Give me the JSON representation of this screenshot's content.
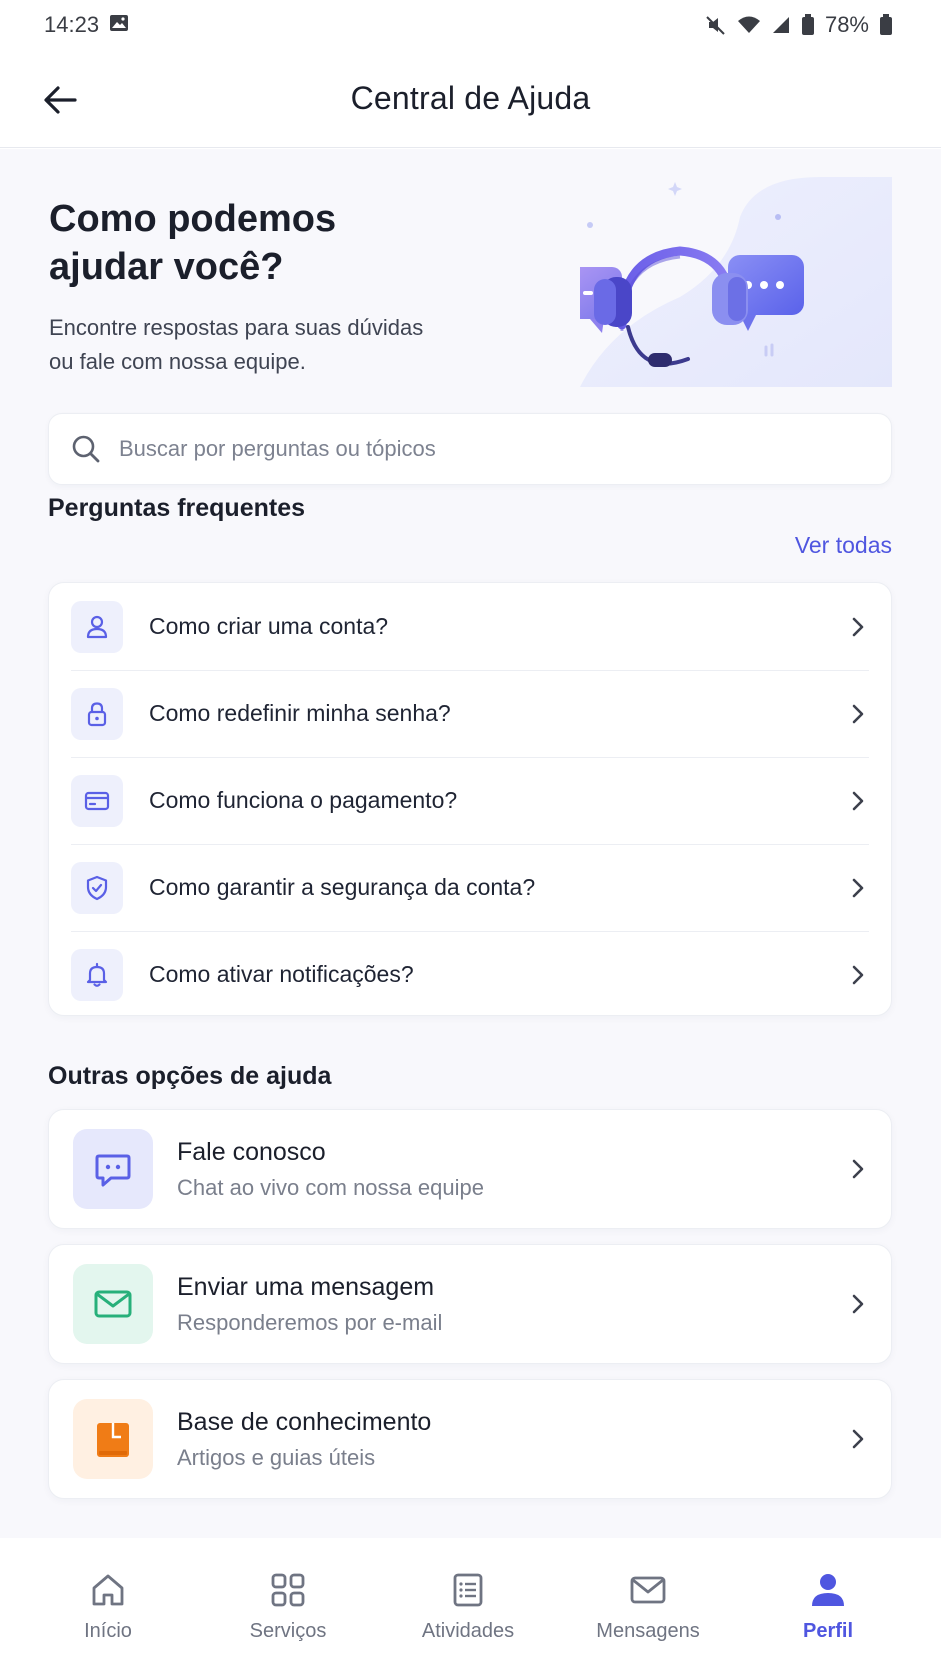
{
  "status_bar": {
    "time": "14:23",
    "battery": "78%",
    "icons": [
      "image-icon",
      "mute-icon",
      "wifi-icon",
      "signal-icon",
      "battery-saver-icon",
      "battery-icon"
    ]
  },
  "header": {
    "back_icon": "arrow-left-icon",
    "title": "Central de Ajuda"
  },
  "hero": {
    "title_line1": "Como podemos",
    "title_line2": "ajudar você?",
    "subtitle_line1": "Encontre respostas para suas dúvidas",
    "subtitle_line2": "ou fale com nossa equipe.",
    "illustration": "headset-support-illustration"
  },
  "search": {
    "placeholder": "Buscar por perguntas ou tópicos",
    "icon": "search-icon"
  },
  "faq": {
    "title": "Perguntas frequentes",
    "see_all": "Ver todas",
    "items": [
      {
        "label": "Como criar uma conta?",
        "icon": "user-icon"
      },
      {
        "label": "Como redefinir minha senha?",
        "icon": "lock-icon"
      },
      {
        "label": "Como funciona o pagamento?",
        "icon": "credit-card-icon"
      },
      {
        "label": "Como garantir a segurança da conta?",
        "icon": "shield-icon"
      },
      {
        "label": "Como ativar notificações?",
        "icon": "bell-icon"
      }
    ]
  },
  "other_help": {
    "title": "Outras opções de ajuda",
    "items": [
      {
        "title": "Fale conosco",
        "subtitle": "Chat ao vivo com nossa equipe",
        "icon": "chat-icon",
        "color": "#5a60e6",
        "bg": "#e6e8fc"
      },
      {
        "title": "Enviar uma mensagem",
        "subtitle": "Responderemos por e-mail",
        "icon": "mail-icon",
        "color": "#27b07a",
        "bg": "#e3f6ee"
      },
      {
        "title": "Base de conhecimento",
        "subtitle": "Artigos e guias úteis",
        "icon": "book-icon",
        "color": "#f07c16",
        "bg": "#fff0e2"
      }
    ]
  },
  "bottom_nav": {
    "items": [
      {
        "label": "Início",
        "icon": "home-icon",
        "active": false
      },
      {
        "label": "Serviços",
        "icon": "grid-icon",
        "active": false
      },
      {
        "label": "Atividades",
        "icon": "list-icon",
        "active": false
      },
      {
        "label": "Mensagens",
        "icon": "mail-icon",
        "active": false
      },
      {
        "label": "Perfil",
        "icon": "profile-icon",
        "active": true
      }
    ]
  },
  "colors": {
    "accent": "#4f56e0",
    "text": "#1f2433",
    "muted": "#7a7f8c",
    "background": "#f8f8fc"
  }
}
